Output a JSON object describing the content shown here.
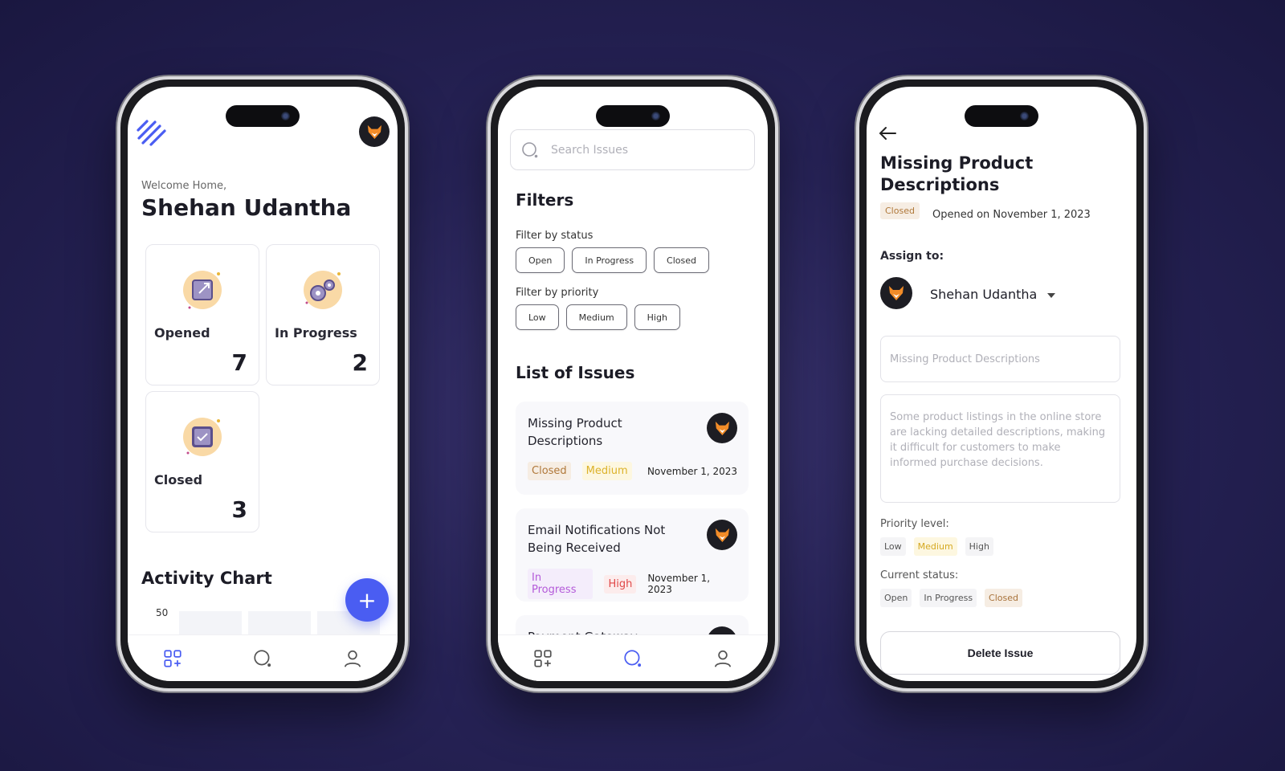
{
  "home": {
    "welcome_sub": "Welcome Home,",
    "user_name": "Shehan Udantha",
    "stats": [
      {
        "label": "Opened",
        "count": "7"
      },
      {
        "label": "In Progress",
        "count": "2"
      },
      {
        "label": "Closed",
        "count": "3"
      }
    ],
    "chart_title": "Activity Chart",
    "chart_tick": "50",
    "fab_label": "+"
  },
  "issues": {
    "search_placeholder": "Search Issues",
    "filters_title": "Filters",
    "filter_status_label": "Filter by status",
    "status_options": [
      "Open",
      "In Progress",
      "Closed"
    ],
    "filter_priority_label": "Filter by priority",
    "priority_options": [
      "Low",
      "Medium",
      "High"
    ],
    "list_title": "List of Issues",
    "items": [
      {
        "title": "Missing Product Descriptions",
        "status": "Closed",
        "priority": "Medium",
        "date": "November 1, 2023"
      },
      {
        "title": "Email Notifications Not Being Received",
        "status": "In Progress",
        "priority": "High",
        "date": "November 1, 2023"
      },
      {
        "title": "Payment Gateway"
      }
    ]
  },
  "detail": {
    "title": "Missing Product Descriptions",
    "status": "Closed",
    "opened": "Opened on November 1, 2023",
    "assign_label": "Assign to:",
    "assignee": "Shehan Udantha",
    "title_field_placeholder": "Missing Product Descriptions",
    "description_placeholder": "Some product listings in the online store are lacking detailed descriptions, making it difficult for customers to make informed purchase decisions.",
    "priority_label": "Priority level:",
    "priority_options": [
      "Low",
      "Medium",
      "High"
    ],
    "priority_selected": "Medium",
    "status_label": "Current status:",
    "status_options": [
      "Open",
      "In Progress",
      "Closed"
    ],
    "status_selected": "Closed",
    "delete_label": "Delete Issue"
  },
  "colors": {
    "accent": "#4a5df2",
    "closed": "#b0783a",
    "medium": "#dcb22a",
    "in_progress": "#b45ad9",
    "high": "#e04848"
  }
}
